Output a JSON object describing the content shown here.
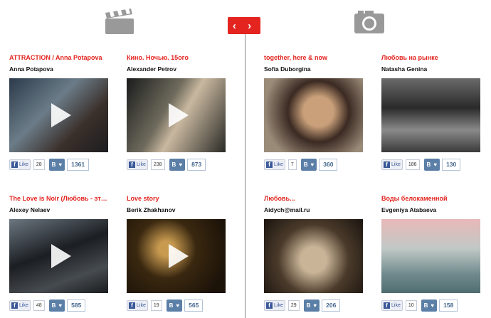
{
  "header": {
    "video_icon": "clapperboard-icon",
    "photo_icon": "camera-icon",
    "toggle_label": "‹ ›"
  },
  "colors": {
    "accent": "#e3241f",
    "vk": "#5b7fa6",
    "facebook": "#3b5998"
  },
  "cards": [
    {
      "title": "ATTRACTION / Anna Potapova",
      "author": "Anna Potapova",
      "type": "video",
      "fb_label": "Like",
      "likes": "28",
      "vk_label": "B",
      "vk_count": "1361"
    },
    {
      "title": "Кино. Ночью. 15ого",
      "author": "Alexander Petrov",
      "type": "video",
      "fb_label": "Like",
      "likes": "238",
      "vk_label": "B",
      "vk_count": "873"
    },
    {
      "title": "together, here & now",
      "author": "Sofia Duborgina",
      "type": "photo",
      "fb_label": "Like",
      "likes": "7",
      "vk_label": "B",
      "vk_count": "360"
    },
    {
      "title": "Любовь на рынке",
      "author": "Natasha Genina",
      "type": "photo",
      "fb_label": "Like",
      "likes": "186",
      "vk_label": "B",
      "vk_count": "130"
    },
    {
      "title": "The Love is Noir (Любовь - это н...",
      "author": "Alexey Nelaev",
      "type": "video",
      "fb_label": "Like",
      "likes": "48",
      "vk_label": "B",
      "vk_count": "585"
    },
    {
      "title": "Love story",
      "author": "Berik Zhakhanov",
      "type": "video",
      "fb_label": "Like",
      "likes": "19",
      "vk_label": "B",
      "vk_count": "565"
    },
    {
      "title": "Любовь...",
      "author": "Aidych@mail.ru",
      "type": "photo",
      "fb_label": "Like",
      "likes": "29",
      "vk_label": "B",
      "vk_count": "206"
    },
    {
      "title": "Воды белокаменной",
      "author": "Evgeniya Atabaeva",
      "type": "photo",
      "fb_label": "Like",
      "likes": "10",
      "vk_label": "B",
      "vk_count": "158"
    }
  ]
}
